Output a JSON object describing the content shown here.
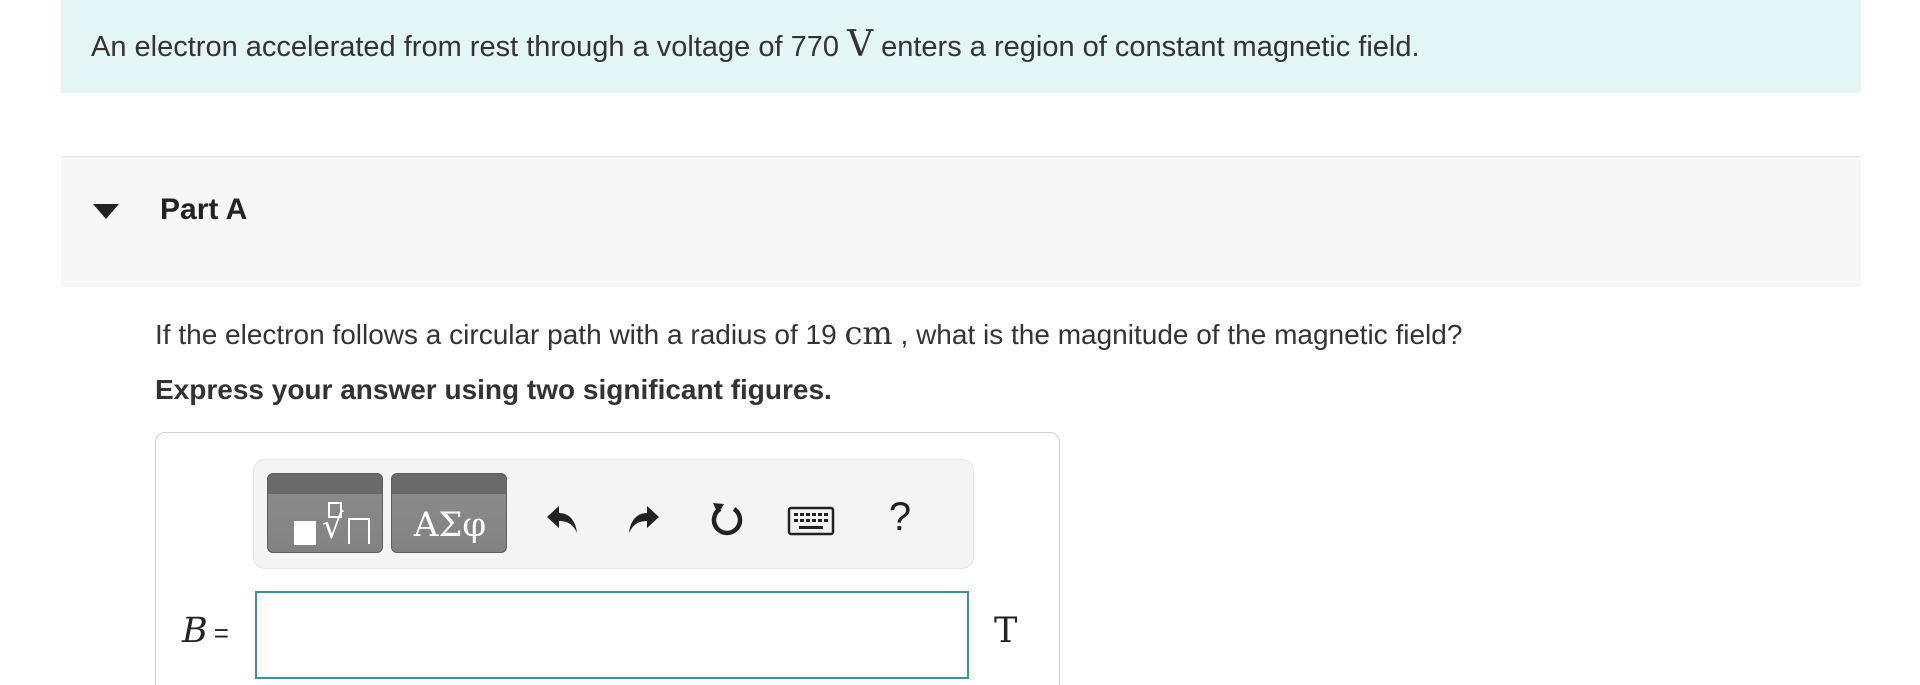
{
  "problem": {
    "text_before": "An electron accelerated from rest through a voltage of 770 ",
    "unit_voltage": "V",
    "text_after": " enters a region of constant magnetic field."
  },
  "part": {
    "title": "Part A",
    "expanded": true
  },
  "question": {
    "text_before": "If the electron follows a circular path with a radius of 19 ",
    "unit_length": "cm",
    "text_after": " , what is the magnitude of the magnetic field?"
  },
  "instruction": "Express your answer using two significant figures.",
  "toolbar": {
    "symbols_label": "ΑΣφ",
    "help_label": "?"
  },
  "answer": {
    "variable": "B",
    "equals": "=",
    "value": "",
    "unit": "T"
  },
  "colors": {
    "banner_bg": "#e3f5f5",
    "part_header_bg": "#f7f7f7",
    "input_border": "#3a8fa3",
    "tool_button_bg": "#828282"
  }
}
